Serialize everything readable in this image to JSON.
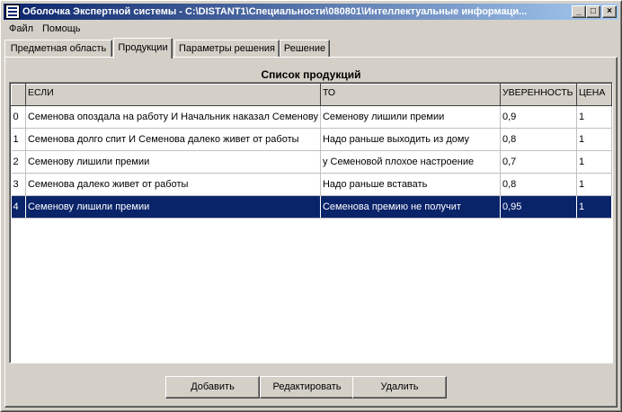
{
  "window": {
    "title": "Оболочка Экспертной системы - C:\\DISTANT1\\Специальности\\080801\\Интеллектуальные информаци...",
    "minimize_label": "_",
    "maximize_label": "□",
    "close_label": "×"
  },
  "menu": {
    "items": [
      {
        "label": "Файл"
      },
      {
        "label": "Помощь"
      }
    ]
  },
  "tabs": [
    {
      "label": "Предметная область",
      "active": false
    },
    {
      "label": "Продукции",
      "active": true
    },
    {
      "label": "Параметры решения",
      "active": false
    },
    {
      "label": "Решение",
      "active": false
    }
  ],
  "panel": {
    "title": "Список продукций"
  },
  "table": {
    "columns": [
      "",
      "ЕСЛИ",
      "ТО",
      "УВЕРЕННОСТЬ",
      "ЦЕНА"
    ],
    "rows": [
      {
        "no": "0",
        "if": "Семенова опоздала на работу И Начальник наказал Семенову",
        "then": "Семенову лишили премии",
        "confidence": "0,9",
        "cost": "1",
        "selected": false
      },
      {
        "no": "1",
        "if": "Семенова долго спит И Семенова далеко живет от работы",
        "then": "Надо раньше выходить из дому",
        "confidence": "0,8",
        "cost": "1",
        "selected": false
      },
      {
        "no": "2",
        "if": "Семенову лишили премии",
        "then": "у Семеновой плохое настроение",
        "confidence": "0,7",
        "cost": "1",
        "selected": false
      },
      {
        "no": "3",
        "if": "Семенова далеко живет от работы",
        "then": "Надо раньше вставать",
        "confidence": "0,8",
        "cost": "1",
        "selected": false
      },
      {
        "no": "4",
        "if": "Семенову лишили премии",
        "then": "Семенова премию не получит",
        "confidence": "0,95",
        "cost": "1",
        "selected": true
      }
    ]
  },
  "buttons": {
    "add": "Добавить",
    "edit": "Редактировать",
    "delete": "Удалить"
  }
}
